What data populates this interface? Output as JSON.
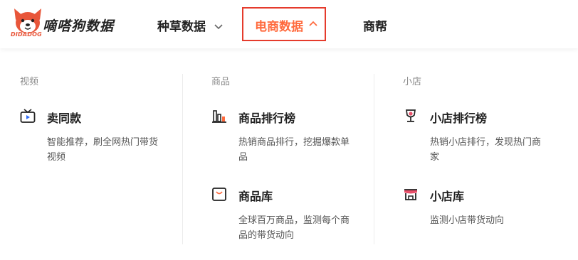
{
  "brand": {
    "name": "嘀嗒狗数据",
    "logo_text": "DIDADOG",
    "logo_icon": "dog-head-icon"
  },
  "nav": [
    {
      "label": "种草数据",
      "icon": "chevron-down-icon"
    },
    {
      "label": "电商数据",
      "icon": "chevron-up-icon",
      "active": true
    },
    {
      "label": "商帮"
    }
  ],
  "colors": {
    "accent": "#ff6a3d",
    "highlight_border": "#e53b2c"
  },
  "dropdown": {
    "columns": [
      {
        "title": "视频",
        "items": [
          {
            "title": "卖同款",
            "desc": "智能推荐，刷全网热门带货视频",
            "icon": "tv-icon"
          }
        ]
      },
      {
        "title": "商品",
        "items": [
          {
            "title": "商品排行榜",
            "desc": "热销商品排行，挖掘爆款单品",
            "icon": "bar-chart-icon"
          },
          {
            "title": "商品库",
            "desc": "全球百万商品，监测每个商品的带货动向",
            "icon": "shopping-bag-icon"
          }
        ]
      },
      {
        "title": "小店",
        "items": [
          {
            "title": "小店排行榜",
            "desc": "热销小店排行，发现热门商家",
            "icon": "trophy-icon"
          },
          {
            "title": "小店库",
            "desc": "监测小店带货动向",
            "icon": "storefront-icon"
          }
        ]
      }
    ]
  }
}
